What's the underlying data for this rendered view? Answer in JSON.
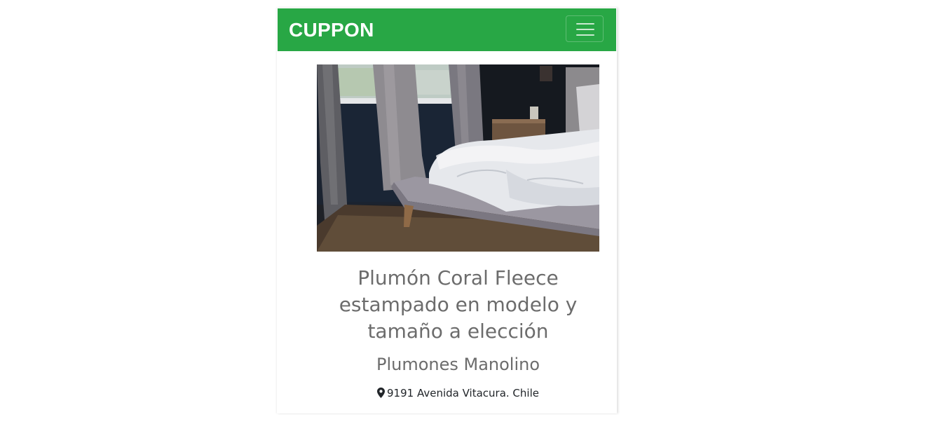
{
  "navbar": {
    "brand": "CUPPON",
    "background_color": "#28a745",
    "toggler_icon": "hamburger-menu-icon"
  },
  "product": {
    "image_description": "bedroom with white duvet on a grey upholstered bed near curtained window",
    "title": "Plumón Coral Fleece estampado en modelo y tamaño a elección",
    "company": "Plumones Manolino",
    "address_icon": "map-marker-icon",
    "address": "9191 Avenida Vitacura. Chile"
  }
}
